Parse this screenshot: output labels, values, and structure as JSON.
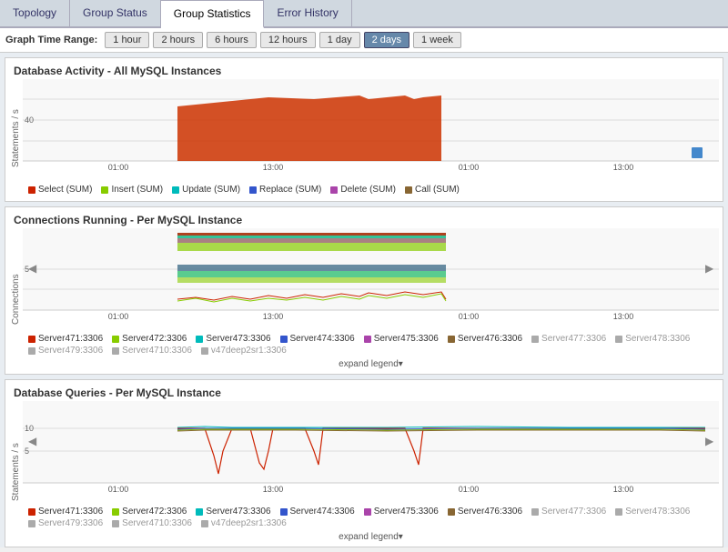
{
  "tabs": [
    {
      "label": "Topology",
      "active": false
    },
    {
      "label": "Group Status",
      "active": false
    },
    {
      "label": "Group Statistics",
      "active": true
    },
    {
      "label": "Error History",
      "active": false
    }
  ],
  "time_range": {
    "label": "Graph Time Range:",
    "options": [
      {
        "label": "1 hour",
        "active": false
      },
      {
        "label": "2 hours",
        "active": false
      },
      {
        "label": "6 hours",
        "active": false
      },
      {
        "label": "12 hours",
        "active": false
      },
      {
        "label": "1 day",
        "active": false
      },
      {
        "label": "2 days",
        "active": true
      },
      {
        "label": "1 week",
        "active": false
      }
    ]
  },
  "charts": [
    {
      "id": "db-activity",
      "title": "Database Activity - All MySQL Instances",
      "y_label": "Statements / s",
      "legend": [
        {
          "color": "#cc2200",
          "label": "Select (SUM)"
        },
        {
          "color": "#88cc00",
          "label": "Insert (SUM)"
        },
        {
          "color": "#00bbbb",
          "label": "Update (SUM)"
        },
        {
          "color": "#3355cc",
          "label": "Replace (SUM)"
        },
        {
          "color": "#aa44aa",
          "label": "Delete (SUM)"
        },
        {
          "color": "#886633",
          "label": "Call (SUM)"
        }
      ],
      "x_labels": [
        "01:00",
        "13:00",
        "01:00",
        "13:00"
      ],
      "y_ticks": [
        "40",
        ""
      ]
    },
    {
      "id": "connections-running",
      "title": "Connections Running - Per MySQL Instance",
      "y_label": "Connections",
      "legend": [
        {
          "color": "#cc2200",
          "label": "Server471:3306"
        },
        {
          "color": "#88cc00",
          "label": "Server472:3306"
        },
        {
          "color": "#00bbbb",
          "label": "Server473:3306"
        },
        {
          "color": "#3355cc",
          "label": "Server474:3306"
        },
        {
          "color": "#aa44aa",
          "label": "Server475:3306"
        },
        {
          "color": "#886633",
          "label": "Server476:3306"
        },
        {
          "color": "#aaa",
          "label": "Server477:3306",
          "gray": true
        },
        {
          "color": "#aaa",
          "label": "Server478:3306",
          "gray": true
        },
        {
          "color": "#aaa",
          "label": "Server479:3306",
          "gray": true
        },
        {
          "color": "#aaa",
          "label": "Server4710:3306",
          "gray": true
        },
        {
          "color": "#aaa",
          "label": "v47deep2sr1:3306",
          "gray": true
        }
      ],
      "x_labels": [
        "01:00",
        "13:00",
        "01:00",
        "13:00"
      ],
      "y_ticks": [
        "5",
        ""
      ],
      "expand": "expand legend▾"
    },
    {
      "id": "db-queries",
      "title": "Database Queries - Per MySQL Instance",
      "y_label": "Statements / s",
      "legend": [
        {
          "color": "#cc2200",
          "label": "Server471:3306"
        },
        {
          "color": "#88cc00",
          "label": "Server472:3306"
        },
        {
          "color": "#00bbbb",
          "label": "Server473:3306"
        },
        {
          "color": "#3355cc",
          "label": "Server474:3306"
        },
        {
          "color": "#aa44aa",
          "label": "Server475:3306"
        },
        {
          "color": "#886633",
          "label": "Server476:3306"
        },
        {
          "color": "#aaa",
          "label": "Server477:3306",
          "gray": true
        },
        {
          "color": "#aaa",
          "label": "Server478:3306",
          "gray": true
        },
        {
          "color": "#aaa",
          "label": "Server479:3306",
          "gray": true
        },
        {
          "color": "#aaa",
          "label": "Server4710:3306",
          "gray": true
        },
        {
          "color": "#aaa",
          "label": "v47deep2sr1:3306",
          "gray": true
        }
      ],
      "x_labels": [
        "01:00",
        "13:00",
        "01:00",
        "13:00"
      ],
      "y_ticks": [
        "10",
        "5"
      ],
      "expand": "expand legend▾"
    }
  ]
}
